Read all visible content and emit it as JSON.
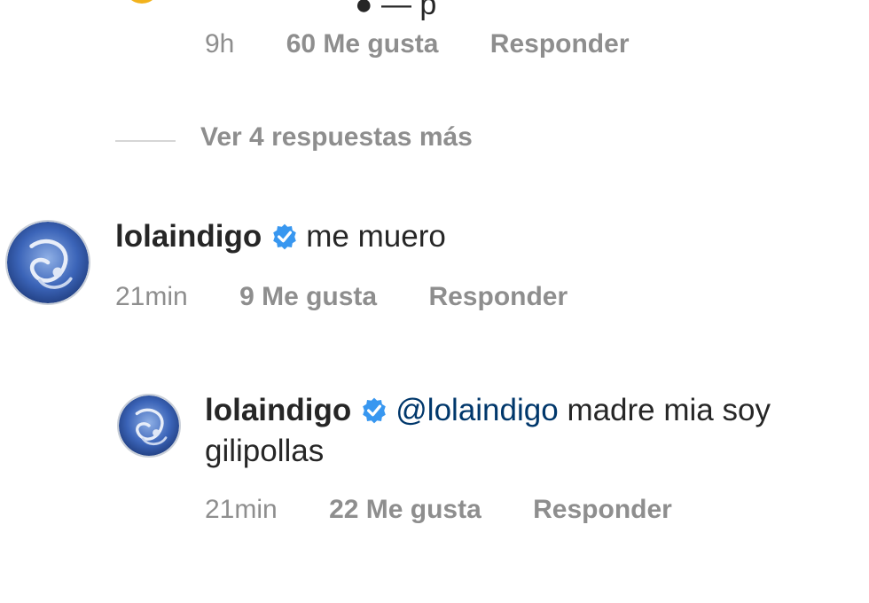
{
  "colors": {
    "text": "#262626",
    "meta": "#8e8e8e",
    "mention": "#00376b",
    "verified": "#3897f0",
    "divider": "#d6d6d6"
  },
  "top_comment": {
    "time": "9h",
    "likes": "60 Me gusta",
    "reply": "Responder"
  },
  "view_more": {
    "label": "Ver 4 respuestas más"
  },
  "comment1": {
    "username": "lolaindigo",
    "verified_icon": "verified-badge-icon",
    "text": "me muero",
    "time": "21min",
    "likes": "9 Me gusta",
    "reply": "Responder"
  },
  "comment2": {
    "username": "lolaindigo",
    "verified_icon": "verified-badge-icon",
    "mention": "@lolaindigo",
    "text_line1": "madre mia soy",
    "text_line2": "gilipollas",
    "time": "21min",
    "likes": "22 Me gusta",
    "reply": "Responder"
  }
}
